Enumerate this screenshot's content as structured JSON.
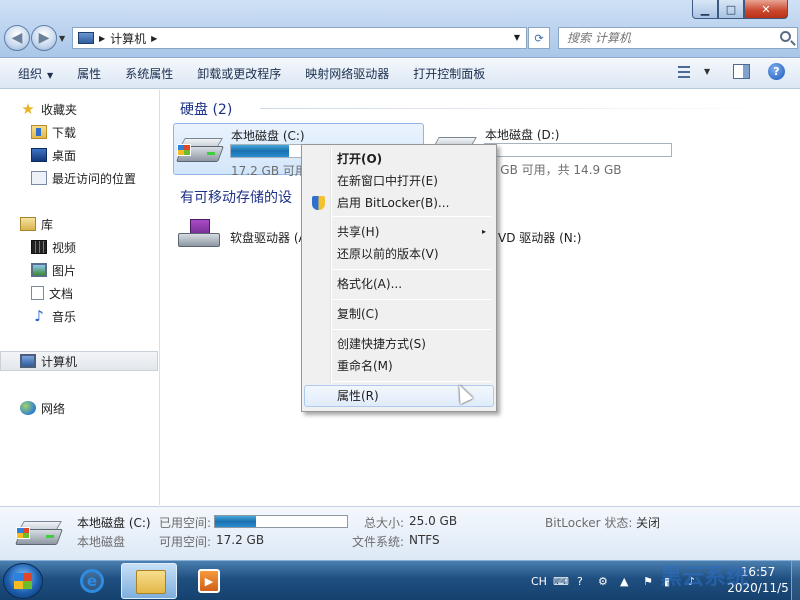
{
  "window": {
    "minimize_glyph": "▁",
    "maximize_glyph": "□",
    "close_glyph": "✕"
  },
  "address": {
    "crumb": "计算机",
    "search_placeholder": "搜索 计算机"
  },
  "toolbar": {
    "organize": "组织",
    "properties": "属性",
    "system_properties": "系统属性",
    "uninstall": "卸载或更改程序",
    "map_drive": "映射网络驱动器",
    "control_panel": "打开控制面板",
    "help_glyph": "?"
  },
  "nav": {
    "favorites": "收藏夹",
    "downloads": "下载",
    "desktop": "桌面",
    "recent": "最近访问的位置",
    "libraries": "库",
    "videos": "视频",
    "pictures": "图片",
    "documents": "文档",
    "music": "音乐",
    "computer": "计算机",
    "network": "网络",
    "star_glyph": "★",
    "music_glyph": "♪"
  },
  "content": {
    "hdd_group": "硬盘 (2)",
    "removable_group": "有可移动存储的设",
    "drives": [
      {
        "name": "本地磁盘 (C:)",
        "free": "17.2 GB 可用",
        "used_fraction": 0.31
      },
      {
        "name": "本地磁盘 (D:)",
        "free": ".8 GB 可用，共 14.9 GB",
        "used_fraction": 0.0
      }
    ],
    "floppy": "软盘驱动器 (A",
    "dvd": "VD 驱动器 (N:)"
  },
  "context_menu": {
    "items": [
      "打开(O)",
      "在新窗口中打开(E)",
      "启用 BitLocker(B)...",
      "共享(H)",
      "还原以前的版本(V)",
      "格式化(A)...",
      "复制(C)",
      "创建快捷方式(S)",
      "重命名(M)",
      "属性(R)"
    ],
    "submenu_glyph": "▸"
  },
  "details": {
    "name": "本地磁盘 (C:)",
    "type": "本地磁盘",
    "used_label": "已用空间:",
    "free_label": "可用空间:",
    "free_value": "17.2 GB",
    "total_label": "总大小:",
    "total_value": "25.0 GB",
    "fs_label": "文件系统:",
    "fs_value": "NTFS",
    "bitlocker_label": "BitLocker 状态:",
    "bitlocker_value": "关闭",
    "used_fraction": 0.31
  },
  "taskbar": {
    "ie_glyph": "e",
    "wmp_glyph": "▶",
    "lang": "CH",
    "time": "16:57",
    "date": "2020/11/5"
  },
  "watermark": {
    "text": "黑云系统"
  },
  "colors": {
    "group_header": "#1e3287",
    "selection": "#d3e6fa",
    "taskbar": "#1f4f80"
  }
}
